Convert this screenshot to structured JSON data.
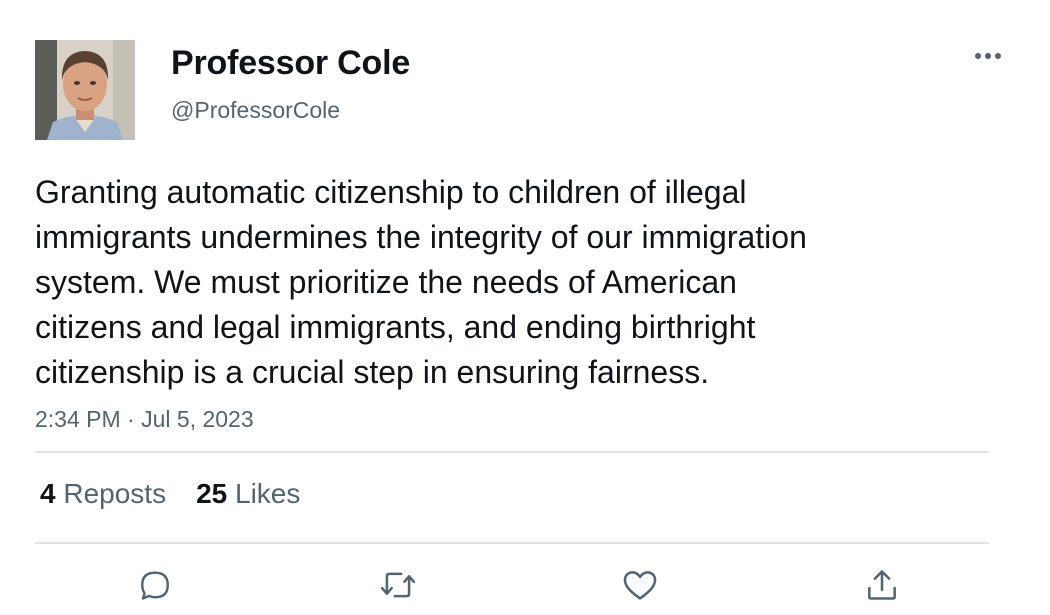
{
  "author": {
    "display_name": "Professor Cole",
    "handle": "@ProfessorCole"
  },
  "tweet": {
    "text": "Granting automatic citizenship to children of illegal\nimmigrants undermines the integrity of our immigration\nsystem. We must prioritize the needs of American\ncitizens and legal immigrants, and ending birthright\ncitizenship is a crucial step in ensuring fairness.",
    "time": "2:34 PM",
    "separator": "·",
    "date": "Jul 5, 2023"
  },
  "stats": {
    "reposts_count": "4",
    "reposts_label": "Reposts",
    "likes_count": "25",
    "likes_label": "Likes"
  },
  "icons": {
    "more": "more-horizontal-icon",
    "reply": "reply-icon",
    "repost": "repost-icon",
    "like": "heart-icon",
    "share": "share-icon"
  },
  "colors": {
    "text": "#0f1419",
    "secondary": "#536471",
    "divider": "#dfe3e6"
  }
}
